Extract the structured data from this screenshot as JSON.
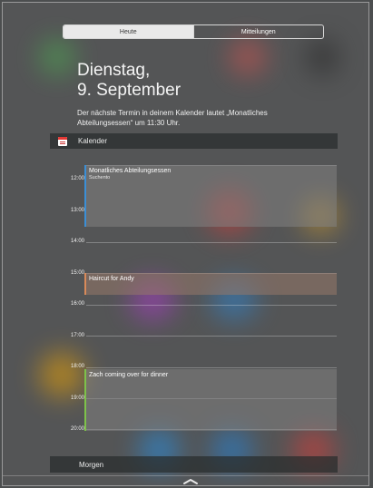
{
  "tabs": [
    {
      "label": "Heute",
      "active": true
    },
    {
      "label": "Mitteilungen",
      "active": false
    }
  ],
  "today": {
    "weekday": "Dienstag,",
    "date": "9. September",
    "summary": "Der nächste Termin in deinem Kalender lautet „Monatliches Abteilungsessen“ um 11:30 Uhr."
  },
  "calendar": {
    "header": "Kalender",
    "icon": "calendar-icon",
    "hours": [
      "12:00",
      "13:00",
      "14:00",
      "15:00",
      "16:00",
      "17:00",
      "18:00",
      "19:00",
      "20:00"
    ],
    "events": [
      {
        "title": "Monatliches Abteilungsessen",
        "location": "Suchento",
        "color": "#3b8fd6"
      },
      {
        "title": "Haircut for Andy",
        "location": "",
        "color": "#d88a5a"
      },
      {
        "title": "Zach coming over for dinner",
        "location": "",
        "color": "#7ec24a"
      }
    ]
  },
  "tomorrow": {
    "label": "Morgen"
  },
  "handle_icon": "chevron-up-handle-icon"
}
